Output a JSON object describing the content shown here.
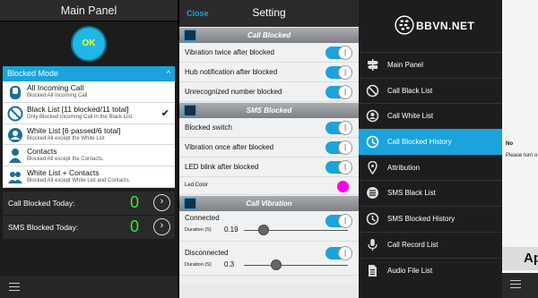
{
  "panel_main": {
    "title": "Main Panel",
    "ok_label": "OK",
    "mode_header": "Blocked Mode",
    "modes": [
      {
        "title": "All Incoming Call",
        "subtitle": "Blocked All Incoming Call"
      },
      {
        "title": "Black List  [11 blocked/11 total]",
        "subtitle": "Only Blocked Incoming Call in the Black List.",
        "checked": true
      },
      {
        "title": "White List [6 passed/6 total]",
        "subtitle": "Blocked All except the White List"
      },
      {
        "title": "Contacts",
        "subtitle": "Blocked All except the Contacts."
      },
      {
        "title": "White List + Contacts",
        "subtitle": "Blocked All except White List and Contacts."
      }
    ],
    "stats": [
      {
        "label": "Call Blocked Today:",
        "value": "0"
      },
      {
        "label": "SMS Blocked Today:",
        "value": "0"
      }
    ]
  },
  "panel_setting": {
    "close_label": "Close",
    "title": "Setting",
    "sections": [
      {
        "title": "Call Blocked",
        "rows": [
          "Vibration twice after blocked",
          "Hub notification after blocked",
          "Unrecognized number blocked"
        ]
      },
      {
        "title": "SMS Blocked",
        "rows": [
          "Blocked switch",
          "Vibration once after blocked",
          "LED blink after blocked"
        ],
        "led_color_label": "Led Color",
        "led_color": "#ff00e6"
      },
      {
        "title": "Call Vibration",
        "rows": [
          {
            "label": "Connected",
            "duration_label": "Duration (S)",
            "duration": "0.19"
          },
          {
            "label": "Disconnected",
            "duration_label": "Duration (S)",
            "duration": "0.3"
          }
        ]
      }
    ],
    "accent_color": "#1aa3dc"
  },
  "panel_nav": {
    "logo": "BBVN.NET",
    "items": [
      {
        "label": "Main Panel",
        "icon": "signpost-icon"
      },
      {
        "label": "Call Black List",
        "icon": "call-block-icon"
      },
      {
        "label": "Call White List",
        "icon": "call-allow-icon"
      },
      {
        "label": "Call Blocked History",
        "icon": "history-icon",
        "active": true
      },
      {
        "label": "Attribution",
        "icon": "location-pin-icon"
      },
      {
        "label": "SMS Black List",
        "icon": "list-icon"
      },
      {
        "label": "SMS Blocked History",
        "icon": "history-icon"
      },
      {
        "label": "Call Record List",
        "icon": "microphone-icon"
      },
      {
        "label": "Audio File List",
        "icon": "document-icon"
      }
    ]
  },
  "panel_partial": {
    "label_no": "No",
    "label_please": "Please turn o",
    "label_ap": "Ap"
  }
}
